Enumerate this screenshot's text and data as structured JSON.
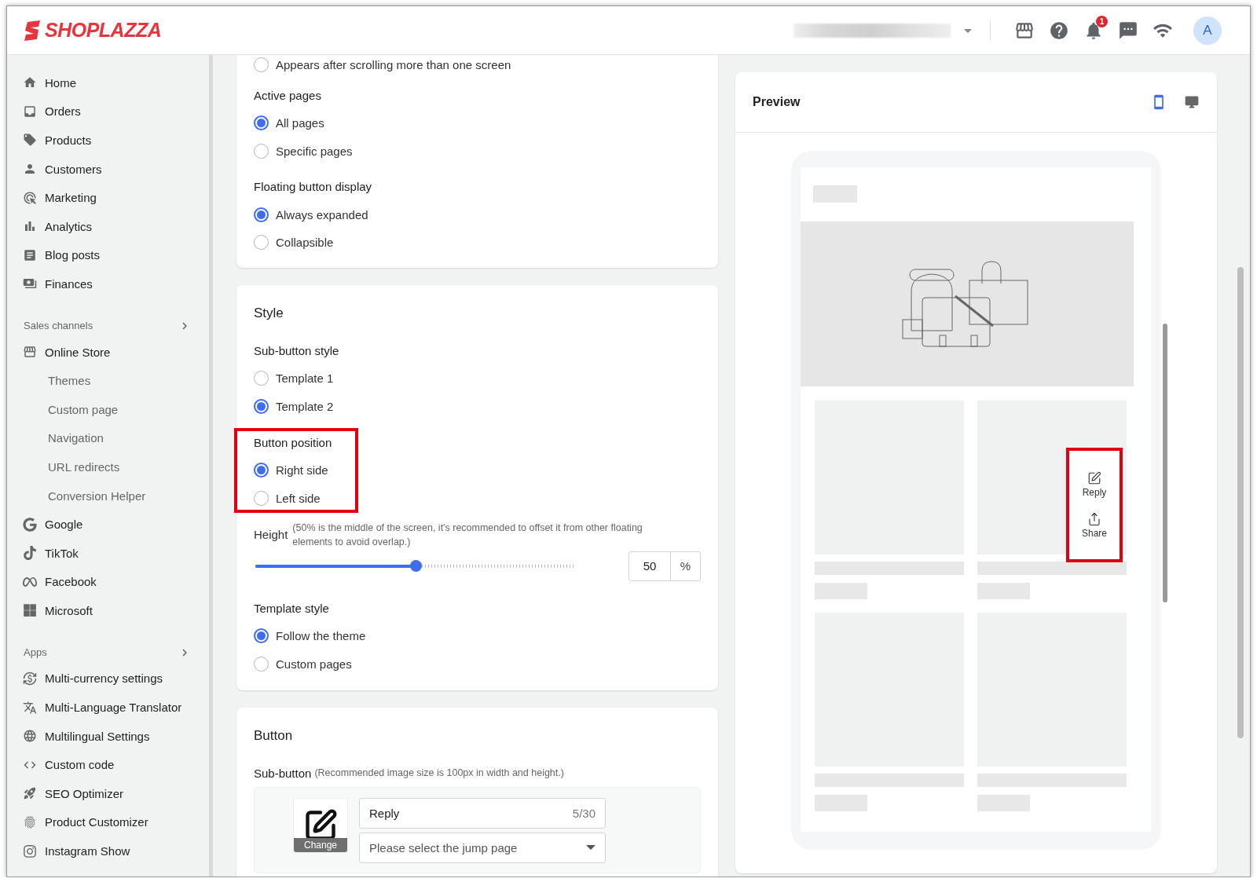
{
  "header": {
    "logo": "SHOPLAZZA",
    "notification_count": "1",
    "avatar": "A"
  },
  "sidebar": {
    "main": [
      {
        "label": "Home"
      },
      {
        "label": "Orders"
      },
      {
        "label": "Products"
      },
      {
        "label": "Customers"
      },
      {
        "label": "Marketing"
      },
      {
        "label": "Analytics"
      },
      {
        "label": "Blog posts"
      },
      {
        "label": "Finances"
      }
    ],
    "sections": [
      {
        "title": "Sales channels",
        "items": [
          {
            "label": "Online Store",
            "children": [
              {
                "label": "Themes"
              },
              {
                "label": "Custom page"
              },
              {
                "label": "Navigation"
              },
              {
                "label": "URL redirects"
              },
              {
                "label": "Conversion Helper"
              }
            ]
          },
          {
            "label": "Google"
          },
          {
            "label": "TikTok"
          },
          {
            "label": "Facebook"
          },
          {
            "label": "Microsoft"
          }
        ]
      },
      {
        "title": "Apps",
        "items": [
          {
            "label": "Multi-currency settings"
          },
          {
            "label": "Multi-Language Translator"
          },
          {
            "label": "Multilingual Settings"
          },
          {
            "label": "Custom code"
          },
          {
            "label": "SEO Optimizer"
          },
          {
            "label": "Product Customizer"
          },
          {
            "label": "Instagram Show"
          }
        ]
      }
    ]
  },
  "display_card": {
    "lead_option": {
      "label": "Appears after scrolling more than one screen",
      "selected": false
    },
    "groups": [
      {
        "title": "Active pages",
        "highlighted": false,
        "options": [
          {
            "label": "All pages",
            "selected": true
          },
          {
            "label": "Specific pages",
            "selected": false
          }
        ]
      },
      {
        "title": "Floating button display",
        "highlighted": false,
        "options": [
          {
            "label": "Always expanded",
            "selected": true
          },
          {
            "label": "Collapsible",
            "selected": false
          }
        ]
      }
    ]
  },
  "style_card": {
    "title": "Style",
    "groups": [
      {
        "title": "Sub-button style",
        "highlighted": false,
        "options": [
          {
            "label": "Template 1",
            "selected": false
          },
          {
            "label": "Template 2",
            "selected": true
          }
        ]
      },
      {
        "title": "Button position",
        "highlighted": true,
        "options": [
          {
            "label": "Right side",
            "selected": true
          },
          {
            "label": "Left side",
            "selected": false
          }
        ]
      }
    ],
    "height": {
      "label": "Height",
      "hint": "(50% is the middle of the screen, it's recommended to offset it from other floating elements to avoid overlap.)",
      "level": 0.5,
      "value": "50",
      "unit": "%"
    },
    "template_style": {
      "title": "Template style",
      "highlighted": false,
      "options": [
        {
          "label": "Follow the theme",
          "selected": true
        },
        {
          "label": "Custom pages",
          "selected": false
        }
      ]
    }
  },
  "button_card": {
    "title": "Button",
    "sub_button_label": "Sub-button",
    "sub_button_hint": "(Recommended image size is 100px in width and height.)",
    "change_label": "Change",
    "name_value": "Reply",
    "name_counter": "5/30",
    "jump_placeholder": "Please select the jump page"
  },
  "preview": {
    "title": "Preview",
    "devices": [
      {
        "kind": "mobile",
        "selected": true
      },
      {
        "kind": "desktop",
        "selected": false
      }
    ],
    "floating": {
      "highlighted": true,
      "buttons": [
        {
          "kind": "reply",
          "label": "Reply"
        },
        {
          "kind": "share",
          "label": "Share"
        }
      ]
    }
  }
}
